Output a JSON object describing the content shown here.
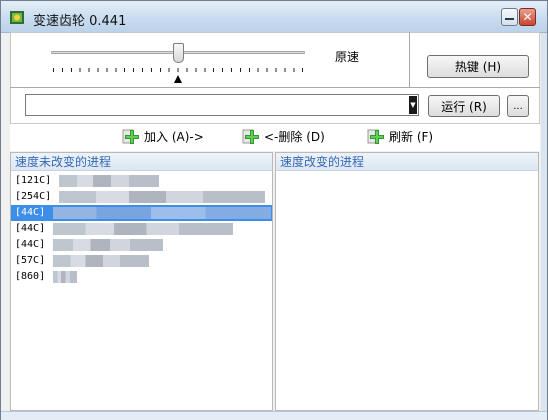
{
  "window": {
    "title": "变速齿轮 0.441",
    "accent": "#3d8ee8"
  },
  "speed": {
    "label": "原速"
  },
  "buttons": {
    "hotkey": "热键 (H)",
    "run": "运行 (R)",
    "more": "..."
  },
  "process_input": {
    "value": ""
  },
  "actions": {
    "add": "加入 (A)->",
    "remove": "<-删除 (D)",
    "refresh": "刷新 (F)"
  },
  "lists": {
    "unchanged_header": "速度未改变的进程",
    "changed_header": "速度改变的进程",
    "unchanged_items": [
      {
        "id": "[121C]"
      },
      {
        "id": "[254C]"
      },
      {
        "id": "[44C]"
      },
      {
        "id": "[44C]"
      },
      {
        "id": "[44C]"
      },
      {
        "id": "[57C]"
      },
      {
        "id": "[860]"
      }
    ],
    "selected_item": "[44C]"
  },
  "icons": {
    "app": "gear-app-icon",
    "add": "green-plus-icon",
    "remove": "green-plus-icon",
    "refresh": "green-plus-icon"
  }
}
